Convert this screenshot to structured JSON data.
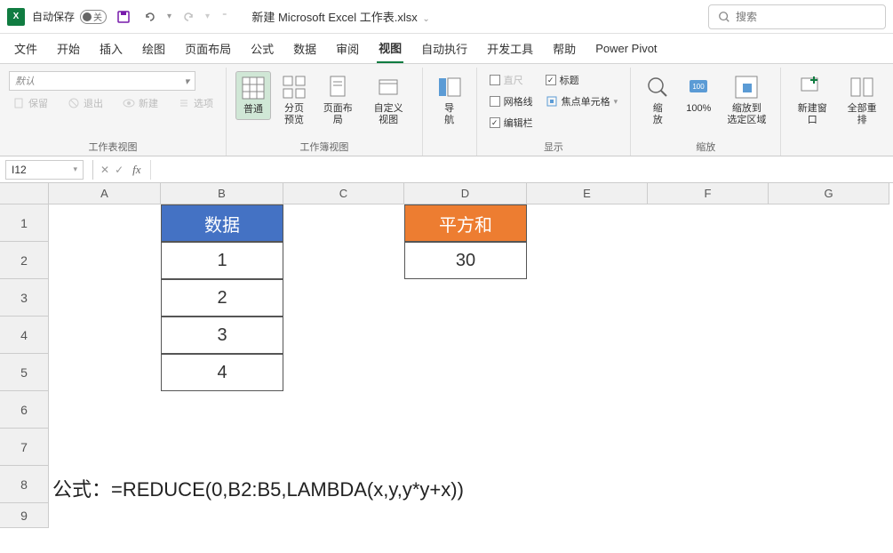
{
  "titlebar": {
    "autosave_label": "自动保存",
    "autosave_state": "关",
    "doc_title": "新建 Microsoft Excel 工作表.xlsx",
    "search_placeholder": "搜索"
  },
  "tabs": {
    "file": "文件",
    "home": "开始",
    "insert": "插入",
    "draw": "绘图",
    "layout": "页面布局",
    "formulas": "公式",
    "data": "数据",
    "review": "审阅",
    "view": "视图",
    "auto": "自动执行",
    "dev": "开发工具",
    "help": "帮助",
    "pp": "Power Pivot"
  },
  "ribbon": {
    "sheetview": {
      "default": "默认",
      "keep": "保留",
      "exit": "退出",
      "new": "新建",
      "options": "选项",
      "group_label": "工作表视图"
    },
    "wbview": {
      "normal": "普通",
      "pagebreak": "分页\n预览",
      "pagelayout": "页面布局",
      "custom": "自定义视图",
      "group_label": "工作簿视图"
    },
    "nav": {
      "nav": "导\n航"
    },
    "show": {
      "ruler": "直尺",
      "gridlines": "网格线",
      "formulabar": "编辑栏",
      "headings": "标题",
      "focus": "焦点单元格",
      "group_label": "显示"
    },
    "zoom": {
      "zoom": "缩\n放",
      "z100": "100%",
      "zoomsel": "缩放到\n选定区域",
      "group_label": "缩放"
    },
    "window": {
      "newwin": "新建窗口",
      "arrange": "全部重排"
    }
  },
  "fxbar": {
    "namebox": "I12",
    "formula": ""
  },
  "grid": {
    "cols": [
      "A",
      "B",
      "C",
      "D",
      "E",
      "F",
      "G"
    ],
    "rows": [
      "1",
      "2",
      "3",
      "4",
      "5",
      "6",
      "7",
      "8",
      "9"
    ],
    "b1": "数据",
    "b2": "1",
    "b3": "2",
    "b4": "3",
    "b5": "4",
    "d1": "平方和",
    "d2": "30",
    "formula_display": "公式：=REDUCE(0,B2:B5,LAMBDA(x,y,y*y+x))"
  }
}
